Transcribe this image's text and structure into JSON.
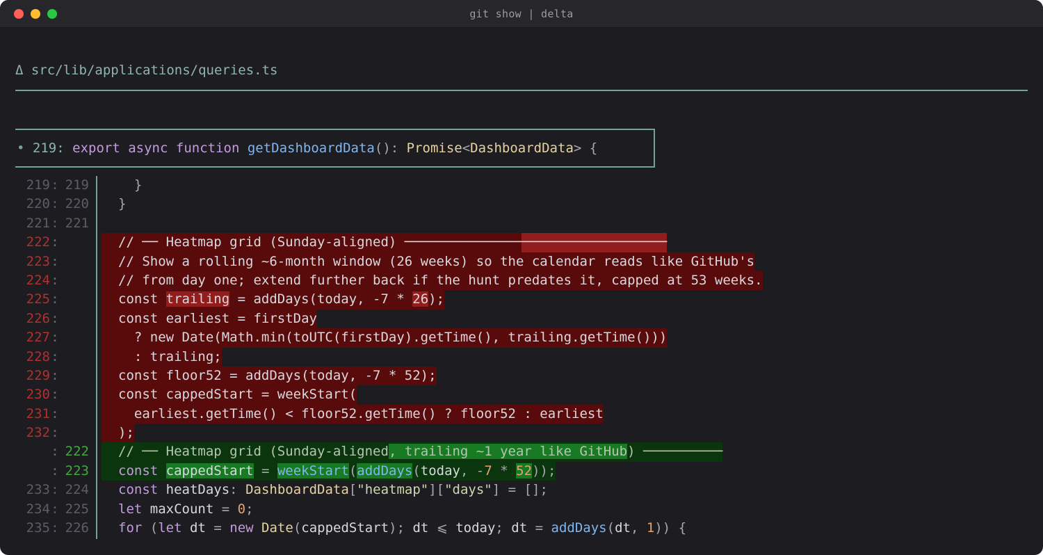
{
  "window": {
    "title": "git show | delta"
  },
  "colors": {
    "removed": "#590b0b",
    "added": "#0b360d",
    "accent": "#6fa59d"
  },
  "file": {
    "header": "Δ src/lib/applications/queries.ts"
  },
  "hunk": {
    "marker": "•",
    "line": "219:",
    "signature_parts": [
      "export",
      "async",
      "function",
      "getDashboardData",
      "(): ",
      "Promise",
      "<",
      "DashboardData",
      "> {"
    ]
  },
  "lines": [
    {
      "type": "ctx",
      "old": "219",
      "new": "219",
      "text": "  }"
    },
    {
      "type": "ctx",
      "old": "220",
      "new": "220",
      "text": "}"
    },
    {
      "type": "ctx",
      "old": "221",
      "new": "221",
      "text": ""
    },
    {
      "type": "del",
      "old": "222",
      "new": "",
      "text": "// ── Heatmap grid (Sunday-aligned) ─────────────────────────────────"
    },
    {
      "type": "del",
      "old": "223",
      "new": "",
      "text": "// Show a rolling ~6-month window (26 weeks) so the calendar reads like GitHub's"
    },
    {
      "type": "del",
      "old": "224",
      "new": "",
      "text": "// from day one; extend further back if the hunt predates it, capped at 53 weeks."
    },
    {
      "type": "del",
      "old": "225",
      "new": "",
      "text": "const trailing = addDays(today, -7 * 26);"
    },
    {
      "type": "del",
      "old": "226",
      "new": "",
      "text": "const earliest = firstDay"
    },
    {
      "type": "del",
      "old": "227",
      "new": "",
      "text": "  ? new Date(Math.min(toUTC(firstDay).getTime(), trailing.getTime()))"
    },
    {
      "type": "del",
      "old": "228",
      "new": "",
      "text": "  : trailing;"
    },
    {
      "type": "del",
      "old": "229",
      "new": "",
      "text": "const floor52 = addDays(today, -7 * 52);"
    },
    {
      "type": "del",
      "old": "230",
      "new": "",
      "text": "const cappedStart = weekStart("
    },
    {
      "type": "del",
      "old": "231",
      "new": "",
      "text": "  earliest.getTime() < floor52.getTime() ? floor52 : earliest"
    },
    {
      "type": "del",
      "old": "232",
      "new": "",
      "text": ");"
    },
    {
      "type": "add",
      "old": "",
      "new": "222",
      "text": "// ── Heatmap grid (Sunday-aligned, trailing ~1 year like GitHub) ──────────"
    },
    {
      "type": "add",
      "old": "",
      "new": "223",
      "text": "const cappedStart = weekStart(addDays(today, -7 * 52));"
    },
    {
      "type": "ctx",
      "old": "233",
      "new": "224",
      "text": "const heatDays: DashboardData[\"heatmap\"][\"days\"] = [];"
    },
    {
      "type": "ctx",
      "old": "234",
      "new": "225",
      "text": "let maxCount = 0;"
    },
    {
      "type": "ctx",
      "old": "235",
      "new": "226",
      "text": "for (let dt = new Date(cappedStart); dt ⩽ today; dt = addDays(dt, 1)) {"
    }
  ]
}
